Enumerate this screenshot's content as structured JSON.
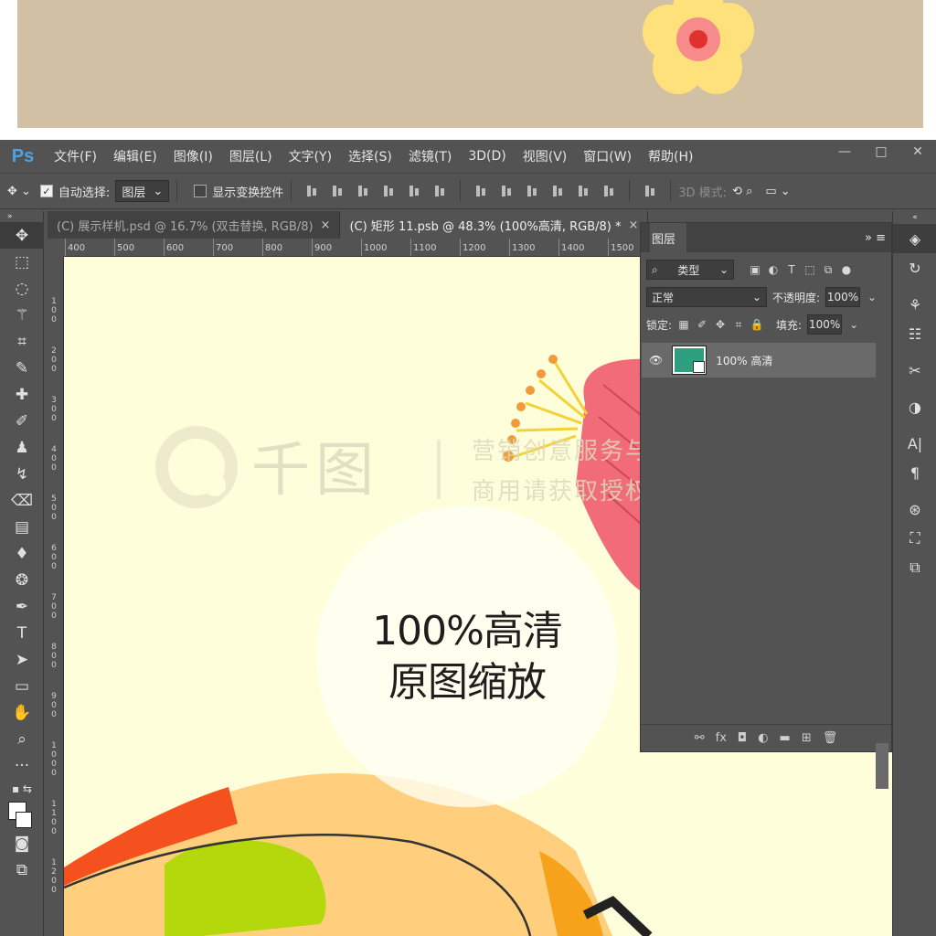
{
  "app": {
    "logo": "Ps"
  },
  "menu": [
    "文件(F)",
    "编辑(E)",
    "图像(I)",
    "图层(L)",
    "文字(Y)",
    "选择(S)",
    "滤镜(T)",
    "3D(D)",
    "视图(V)",
    "窗口(W)",
    "帮助(H)"
  ],
  "window_controls": {
    "minimize": "—",
    "restore": "□",
    "close": "✕"
  },
  "options": {
    "auto_select_label": "自动选择:",
    "auto_select_value": "图层",
    "show_transform_label": "显示变换控件",
    "mode_3d_label": "3D 模式:"
  },
  "tabs": [
    {
      "label": "(C) 展示样机.psd @ 16.7% (双击替换, RGB/8)",
      "close": "×"
    },
    {
      "label": "(C) 矩形 11.psb @ 48.3% (100%高清, RGB/8) *",
      "close": "×"
    }
  ],
  "ruler": {
    "top": [
      "400",
      "500",
      "600",
      "700",
      "800",
      "900",
      "1000",
      "1100",
      "1200",
      "1300",
      "1400",
      "1500"
    ]
  },
  "canvas": {
    "zoom_line1": "100%高清",
    "zoom_line2": "原图缩放",
    "watermark_brand": "千图",
    "watermark_line1": "营销创意服务与协作平台",
    "watermark_line2": "商用请获取授权"
  },
  "layers": {
    "panel_title": "图层",
    "filter_label": "类型",
    "blend_mode": "正常",
    "opacity_label": "不透明度:",
    "opacity_value": "100%",
    "lock_label": "锁定:",
    "fill_label": "填充:",
    "fill_value": "100%",
    "layer_name": "100% 高清"
  },
  "colors": {
    "preview_bg": "#d2c0a4",
    "canvas_bg": "#fffedb",
    "ps_panel": "#535353",
    "layer_thumb": "#2e9e7f",
    "ps_logo": "#4aa3e8"
  }
}
